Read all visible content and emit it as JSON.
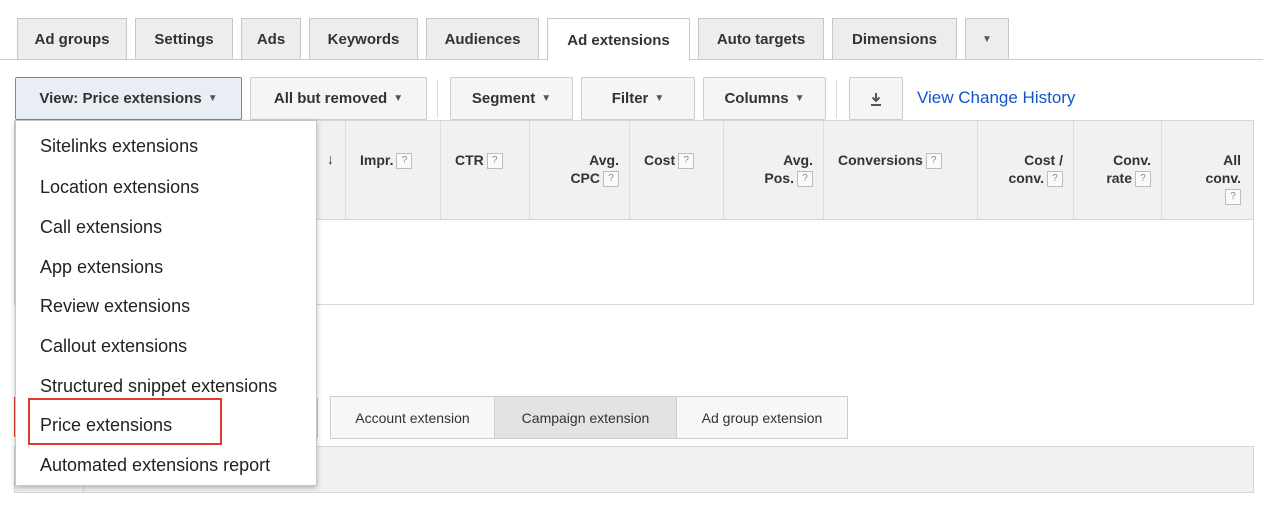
{
  "tabs": [
    {
      "label": "Ad groups"
    },
    {
      "label": "Settings"
    },
    {
      "label": "Ads"
    },
    {
      "label": "Keywords"
    },
    {
      "label": "Audiences"
    },
    {
      "label": "Ad extensions",
      "active": true
    },
    {
      "label": "Auto targets"
    },
    {
      "label": "Dimensions"
    },
    {
      "label": "more-tabs-dropdown"
    }
  ],
  "toolbar": {
    "view_label": "View: Price extensions",
    "status_label": "All but removed",
    "segment_label": "Segment",
    "filter_label": "Filter",
    "columns_label": "Columns",
    "download_icon": "download-icon",
    "change_history_link": "View Change History"
  },
  "table": {
    "columns": [
      {
        "line1": "Impr.",
        "line2": ""
      },
      {
        "line1": "CTR",
        "line2": ""
      },
      {
        "line1": "Avg.",
        "line2": "CPC"
      },
      {
        "line1": "Cost",
        "line2": ""
      },
      {
        "line1": "Avg.",
        "line2": "Pos."
      },
      {
        "line1": "Conversions",
        "line2": ""
      },
      {
        "line1": "Cost /",
        "line2": "conv."
      },
      {
        "line1": "Conv.",
        "line2": "rate"
      },
      {
        "line1": "All",
        "line2": "conv."
      }
    ],
    "help_symbol": "?",
    "sort_arrow": "↓"
  },
  "view_menu": {
    "items": [
      "Sitelinks extensions",
      "Location extensions",
      "Call extensions",
      "App extensions",
      "Review extensions",
      "Callout extensions",
      "Structured snippet extensions",
      "Price extensions",
      "Automated extensions report"
    ],
    "highlighted_index": 7
  },
  "extension_level": {
    "options": [
      "Account extension",
      "Campaign extension",
      "Ad group extension"
    ],
    "selected": "Campaign extension"
  },
  "colors": {
    "link": "#1155cc",
    "highlight_border": "#e03a31",
    "active_view_border": "#5b8bd6"
  }
}
